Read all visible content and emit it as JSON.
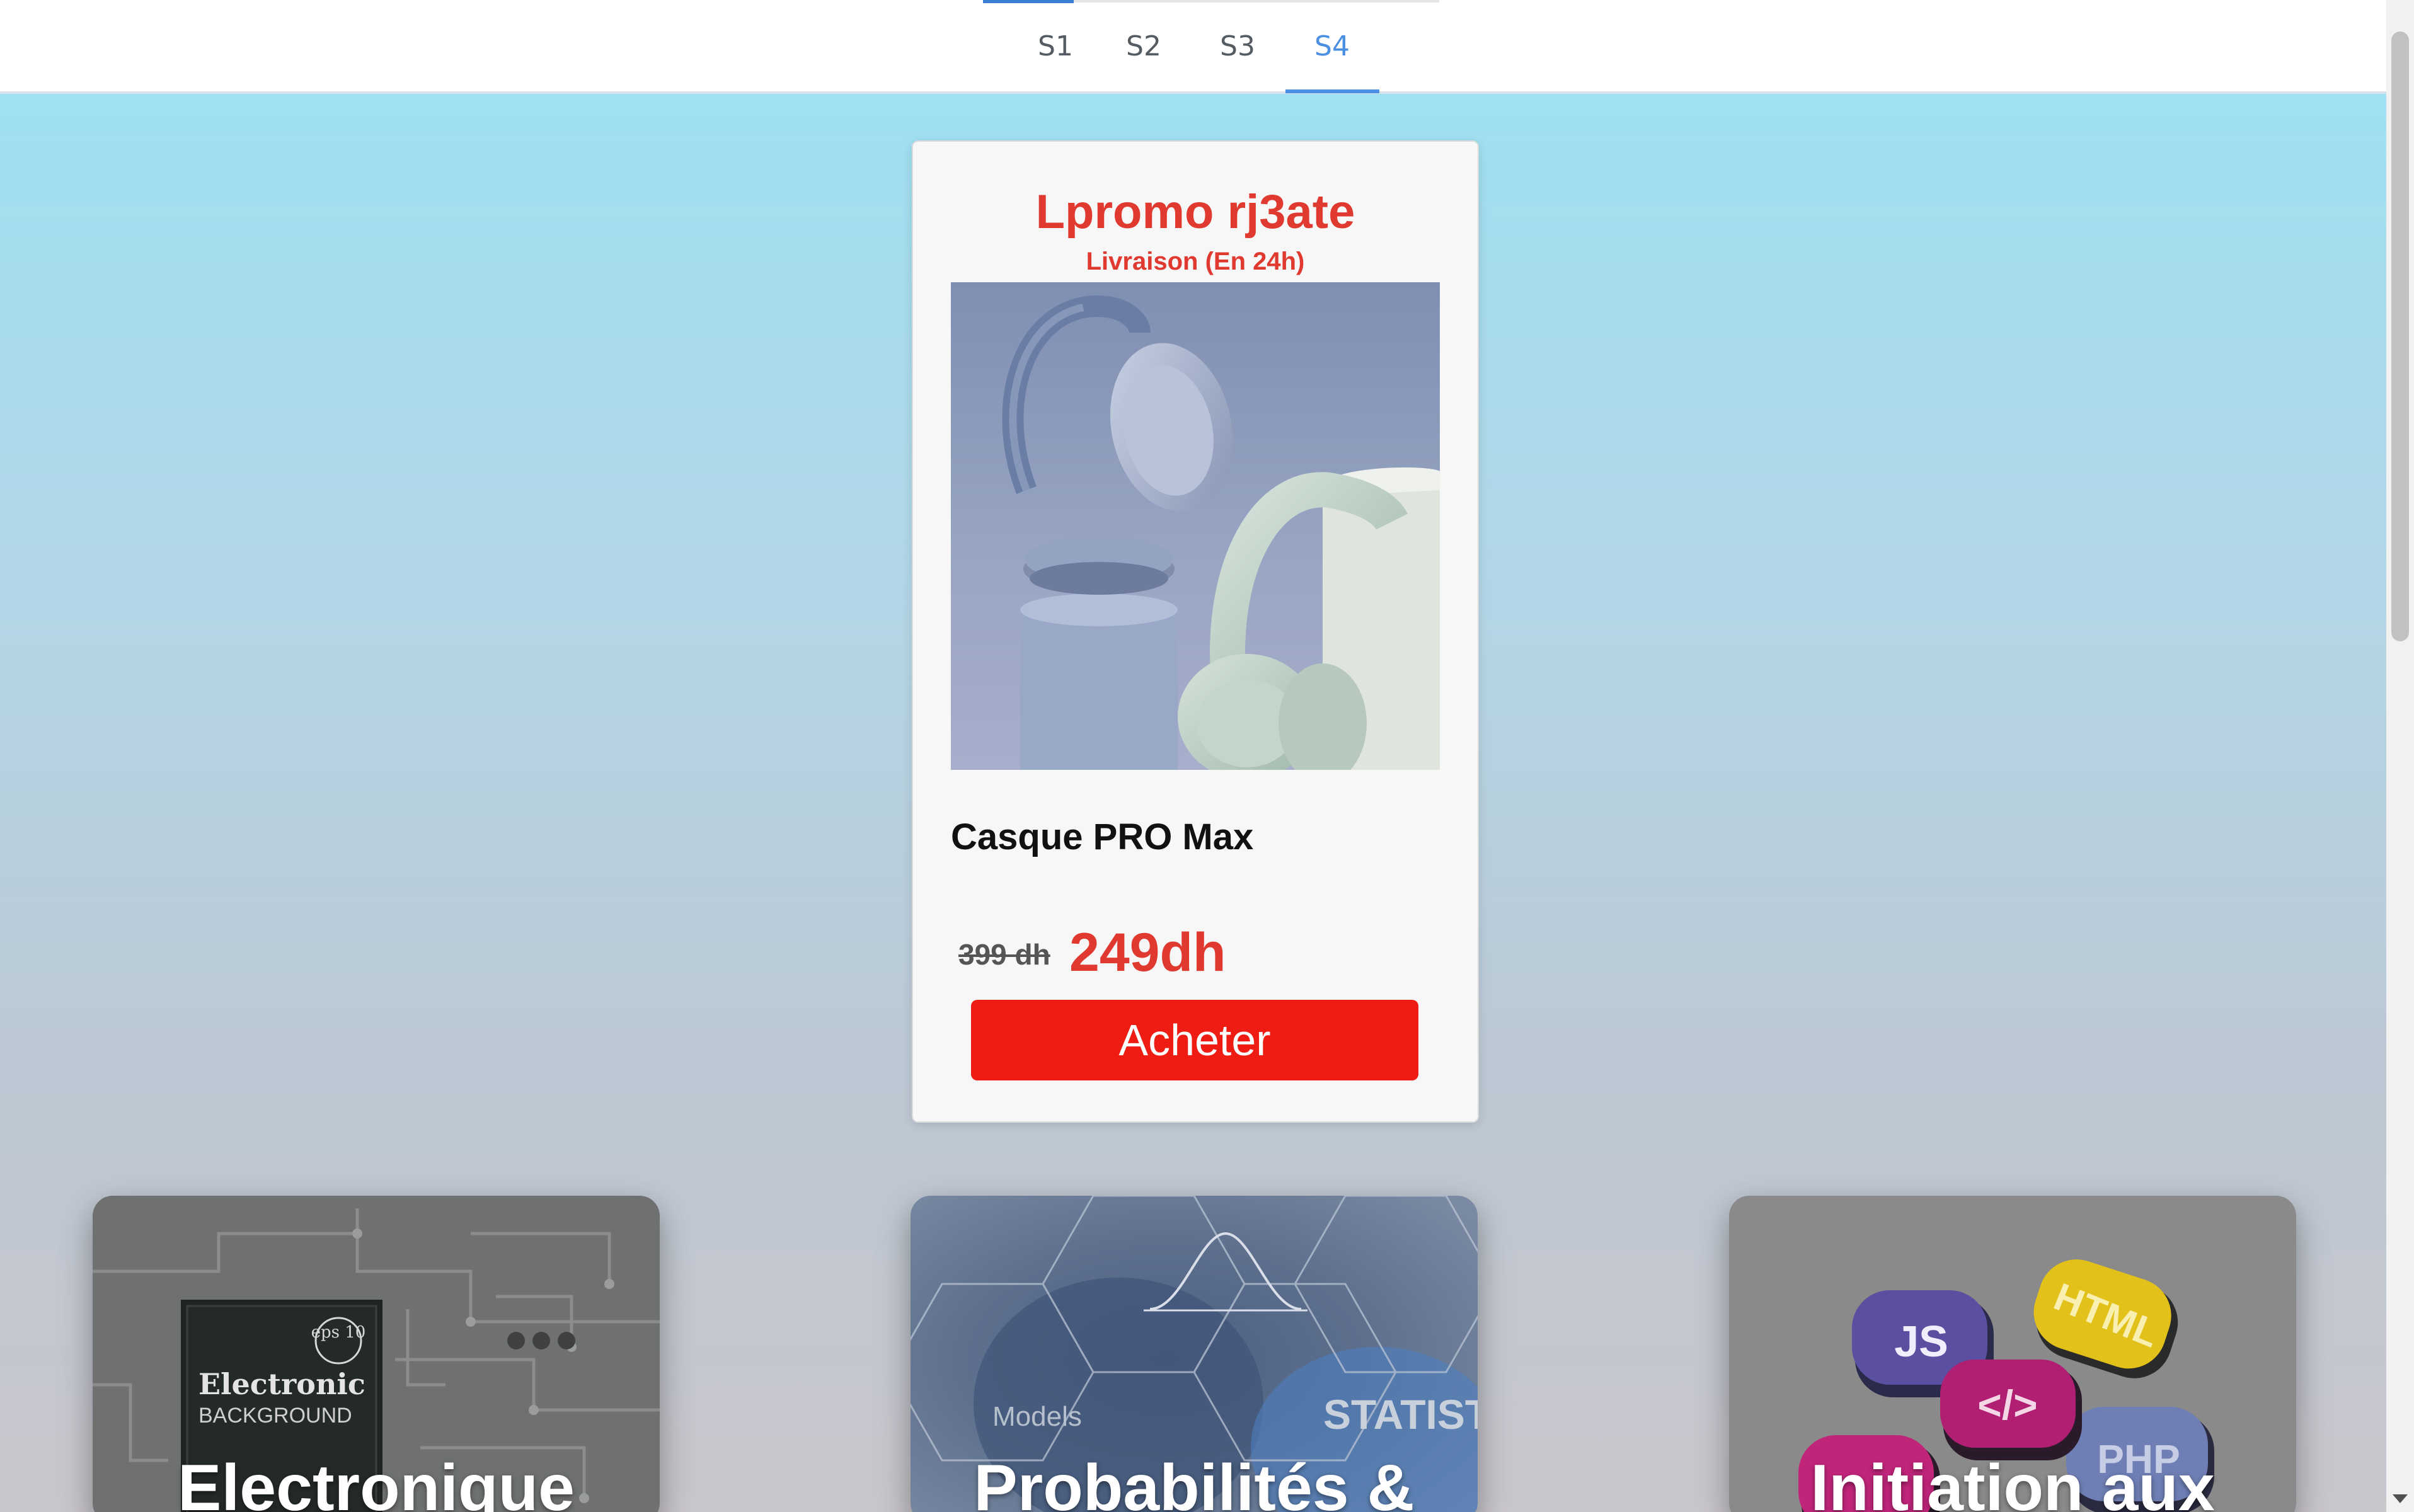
{
  "nav": {
    "tabs": [
      {
        "label": "S1",
        "active": false
      },
      {
        "label": "S2",
        "active": false
      },
      {
        "label": "S3",
        "active": false
      },
      {
        "label": "S4",
        "active": true
      }
    ]
  },
  "promo_card": {
    "title": "Lpromo rj3ate",
    "subtitle": "Livraison (En 24h)",
    "product_image": "headphones-image",
    "product_name": "Casque PRO Max",
    "old_price": "399 dh",
    "new_price": "249dh",
    "buy_label": "Acheter"
  },
  "courses": [
    {
      "title": "Electronique",
      "image": "circuit-board-image",
      "image_text": {
        "brand": "Electronic",
        "sub": "BACKGROUND",
        "badge": "eps 10"
      }
    },
    {
      "title": "Probabilités &",
      "image": "statistics-image",
      "image_text": {
        "models": "Models",
        "stat": "STATIST"
      }
    },
    {
      "title": "Initiation aux",
      "image": "web-languages-image",
      "image_text": {
        "js": "JS",
        "html": "HTML",
        "code": "</>",
        "php": "PHP"
      }
    }
  ],
  "colors": {
    "accent_red": "#e0392f",
    "button_red": "#ee1c12",
    "tab_active": "#4a8fe3"
  }
}
